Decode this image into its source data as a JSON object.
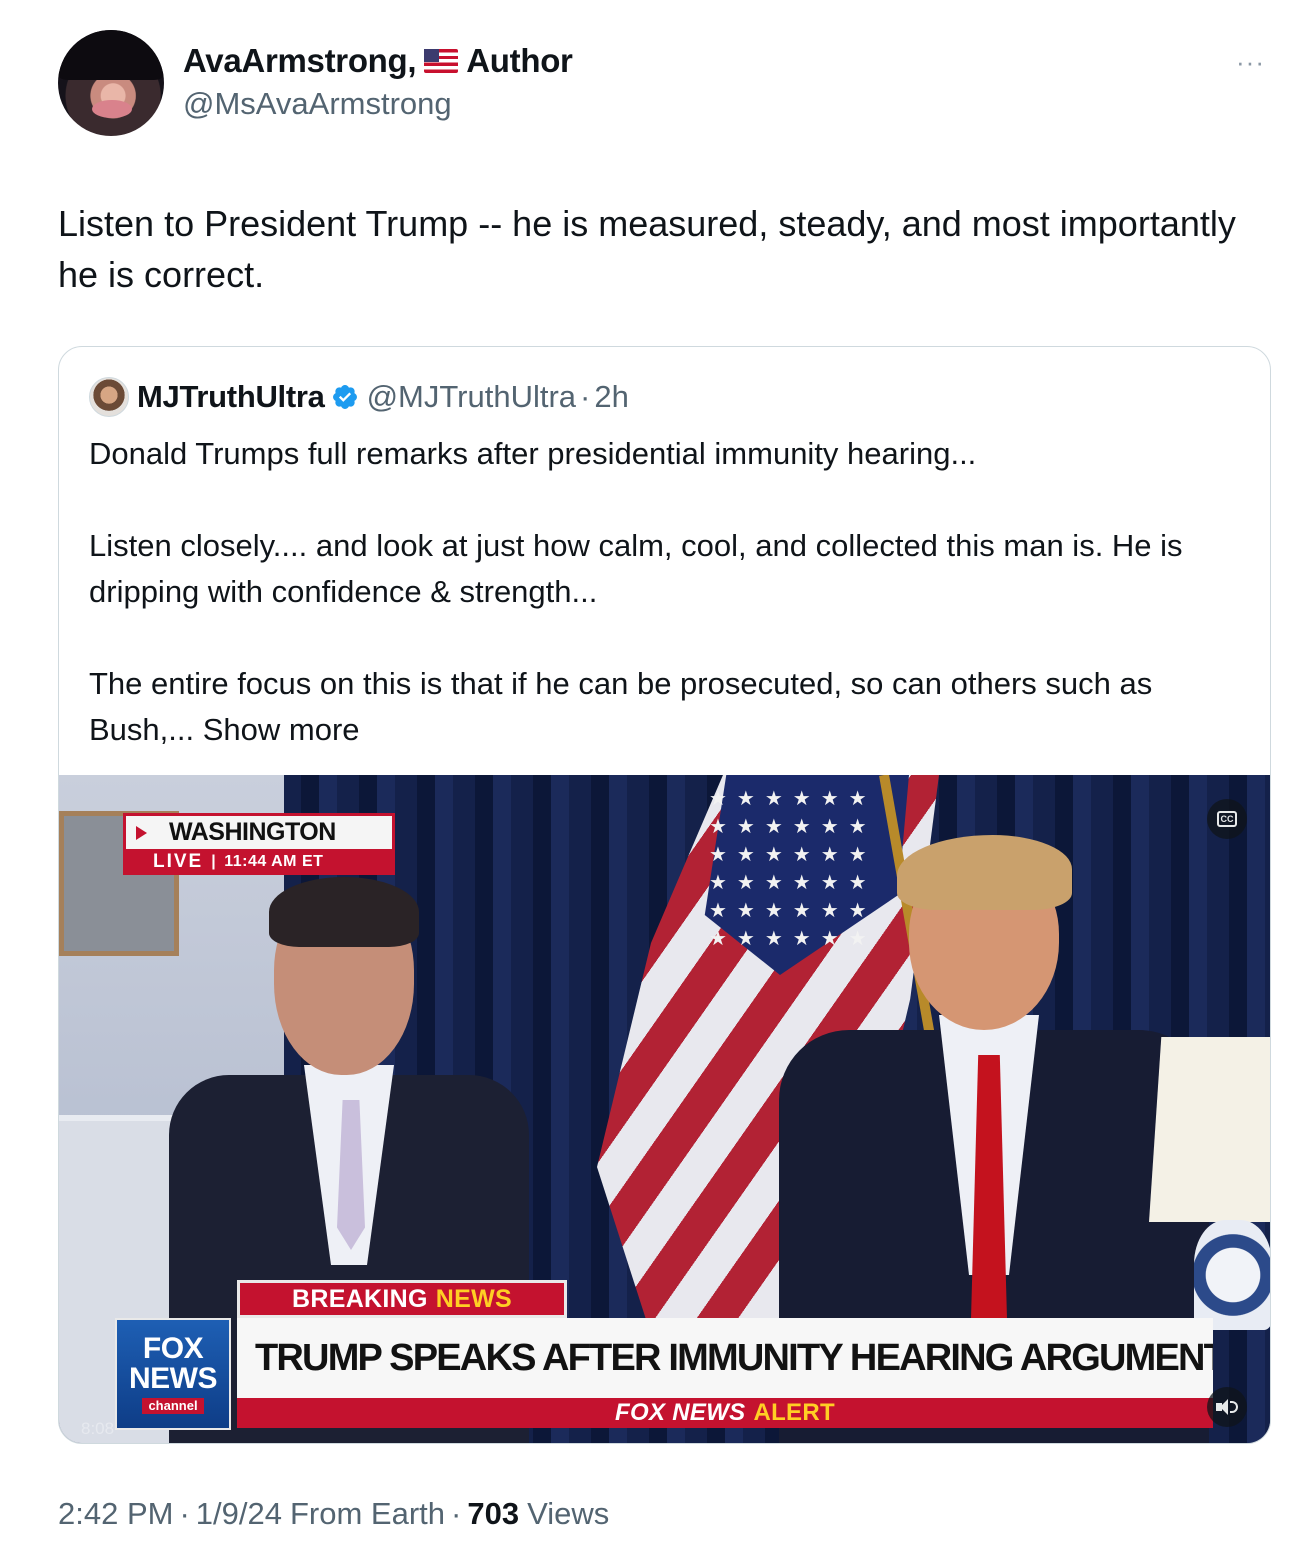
{
  "author": {
    "name": "AvaArmstrong,",
    "title_suffix": "Author",
    "handle": "@MsAvaArmstrong",
    "flag_icon": "us-flag-emoji",
    "more_icon_text": "···"
  },
  "tweet": {
    "text": "Listen to President Trump -- he is measured, steady, and most importantly he is correct."
  },
  "quote": {
    "name": "MJTruthUltra",
    "verified_icon": "verified-badge-icon",
    "handle": "@MJTruthUltra",
    "separator": "·",
    "time": "2h",
    "paragraph_1": "Donald Trumps full remarks after presidential immunity hearing...",
    "paragraph_2": "Listen closely.... and look at just how calm, cool, and collected this man is. He is dripping with confidence & strength...",
    "paragraph_3": "The entire focus on this is that if he can be prosecuted, so can others such as Bush,...",
    "show_more": "Show more"
  },
  "video": {
    "location": "WASHINGTON",
    "live_label": "LIVE",
    "live_sep": "|",
    "live_time": "11:44 AM ET",
    "breaking_word": "BREAKING",
    "news_word": "NEWS",
    "headline": "TRUMP SPEAKS AFTER IMMUNITY HEARING ARGUMENTS WRAP",
    "alert_brand": "FOX NEWS",
    "alert_word": "ALERT",
    "logo_line1": "FOX",
    "logo_line2": "NEWS",
    "logo_line3": "channel",
    "timecode": "8:08",
    "cc_text": "CC",
    "stars": "★★★★★★★★★★★★★★★★★★★★★★★★★★★★★★★★★★★★★★★★"
  },
  "meta": {
    "time": "2:42 PM",
    "dot": "·",
    "date": "1/9/24",
    "source": "From Earth",
    "views_count": "703",
    "views_label": "Views"
  },
  "colors": {
    "text_primary": "#0f1419",
    "text_secondary": "#536471",
    "verified_blue": "#1d9bf0",
    "fox_red": "#c4122f",
    "fox_yellow": "#ffcf24"
  }
}
